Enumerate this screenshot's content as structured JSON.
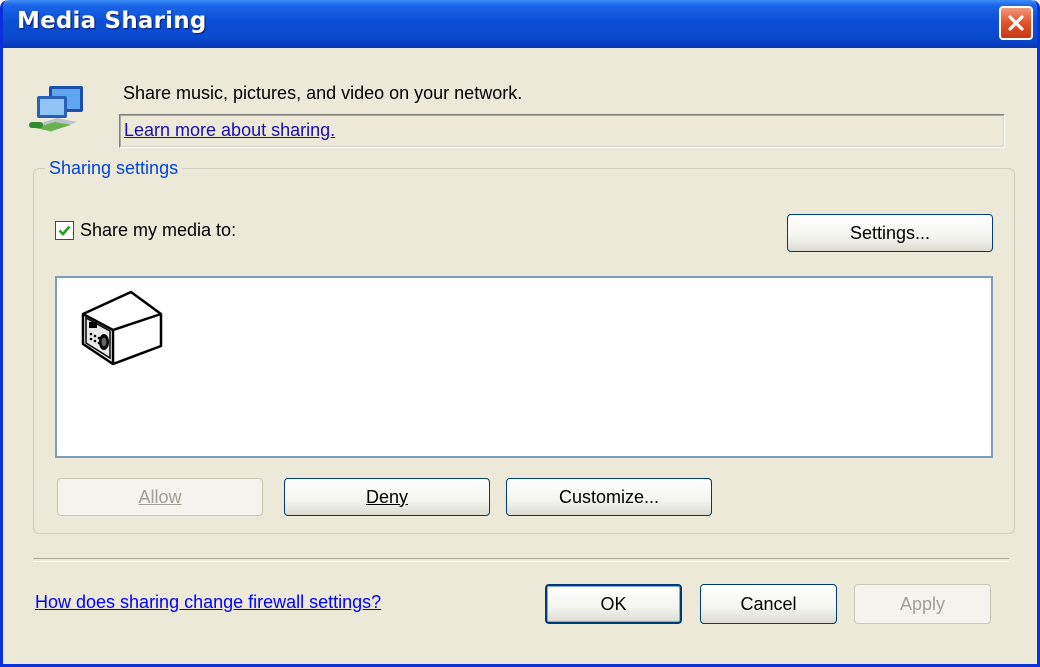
{
  "window": {
    "title": "Media Sharing"
  },
  "intro": {
    "text": "Share music, pictures, and video on your network.",
    "link": "Learn more about sharing."
  },
  "sharing": {
    "group_label": "Sharing settings",
    "share_checkbox": {
      "label": "Share my media to:",
      "checked": true
    },
    "settings_button": "Settings...",
    "devices": [
      {
        "icon": "internet-radio-icon"
      }
    ],
    "buttons": {
      "allow": "Allow",
      "deny": "Deny",
      "customize": "Customize..."
    }
  },
  "footer": {
    "firewall_link": "How does sharing change firewall settings?",
    "ok": "OK",
    "cancel": "Cancel",
    "apply": "Apply"
  },
  "colors": {
    "titlebar": "#0a4fd6",
    "face": "#ece9d8",
    "link": "#0000ff",
    "group_label": "#0046d5"
  }
}
